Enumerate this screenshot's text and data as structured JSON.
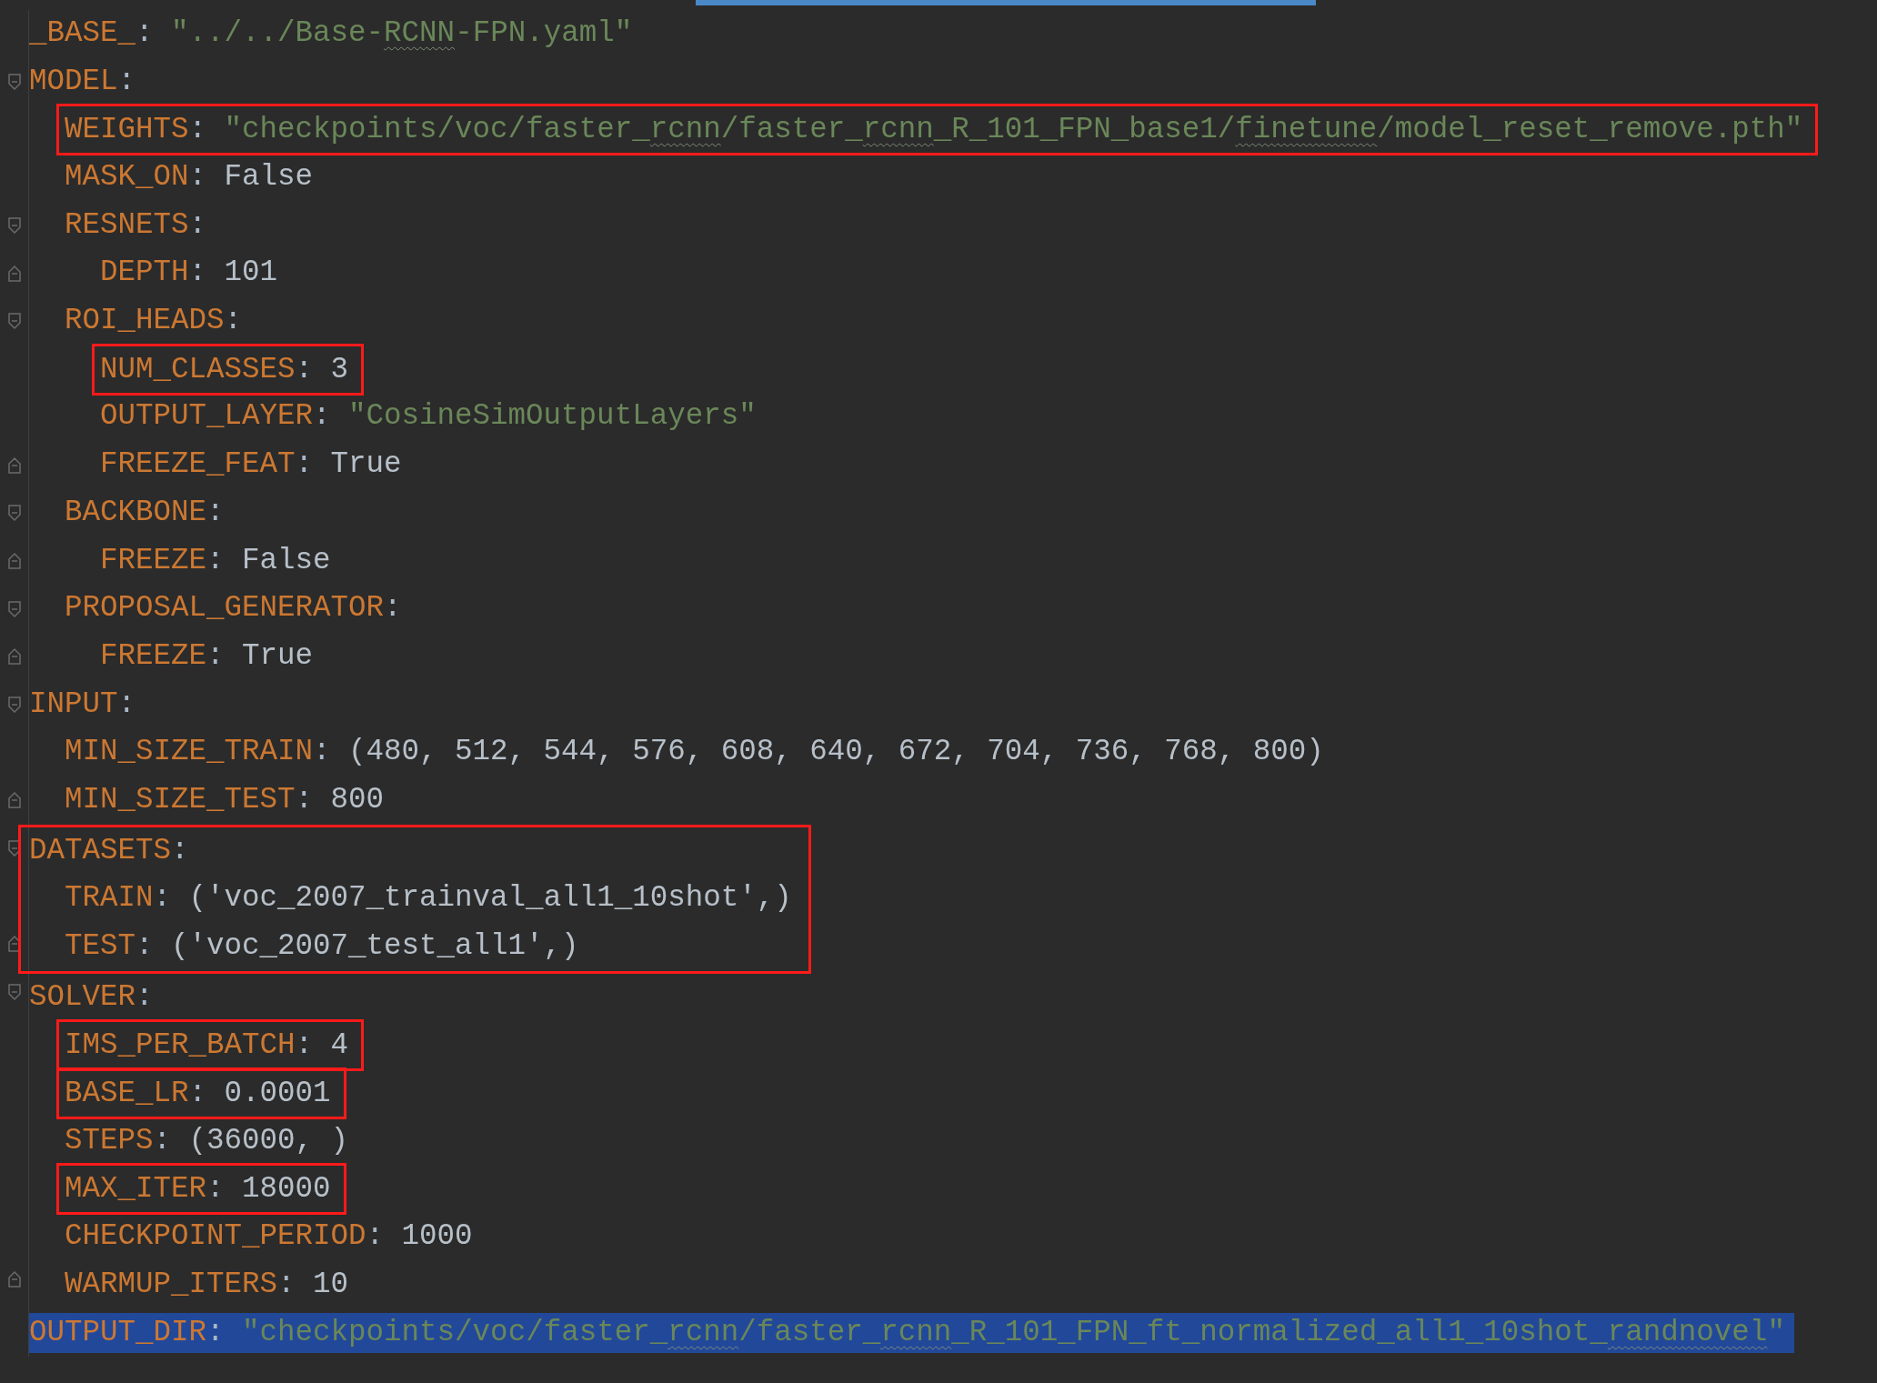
{
  "editor": {
    "lines": [
      {
        "key": "_BASE_",
        "sep": ":",
        "kind": "string",
        "value_parts": [
          {
            "text": "\"../../Base-",
            "typo": false
          },
          {
            "text": "RCNN",
            "typo": true
          },
          {
            "text": "-FPN.yaml\"",
            "typo": false
          }
        ],
        "highlighted": false,
        "selected": false
      },
      {
        "key": "MODEL",
        "sep": ":",
        "highlighted": false,
        "selected": false,
        "children": [
          {
            "key": "WEIGHTS",
            "sep": ":",
            "kind": "string",
            "value_parts": [
              {
                "text": "\"checkpoints/voc/faster_",
                "typo": false
              },
              {
                "text": "rcnn",
                "typo": true
              },
              {
                "text": "/faster_",
                "typo": false
              },
              {
                "text": "rcnn",
                "typo": true
              },
              {
                "text": "_R_101_FPN_base1/",
                "typo": false
              },
              {
                "text": "finetune",
                "typo": true
              },
              {
                "text": "/model_reset_remove.pth\"",
                "typo": false
              }
            ],
            "highlighted": true,
            "selected": false
          },
          {
            "key": "MASK_ON",
            "sep": ":",
            "kind": "plain",
            "value": "False",
            "highlighted": false,
            "selected": false
          },
          {
            "key": "RESNETS",
            "sep": ":",
            "highlighted": false,
            "selected": false,
            "children": [
              {
                "key": "DEPTH",
                "sep": ":",
                "kind": "plain",
                "value": "101",
                "highlighted": false,
                "selected": false
              }
            ]
          },
          {
            "key": "ROI_HEADS",
            "sep": ":",
            "highlighted": false,
            "selected": false,
            "children": [
              {
                "key": "NUM_CLASSES",
                "sep": ":",
                "kind": "plain",
                "value": "3",
                "highlighted": true,
                "selected": false
              },
              {
                "key": "OUTPUT_LAYER",
                "sep": ":",
                "kind": "string",
                "value": "\"CosineSimOutputLayers\"",
                "highlighted": false,
                "selected": false
              },
              {
                "key": "FREEZE_FEAT",
                "sep": ":",
                "kind": "plain",
                "value": "True",
                "highlighted": false,
                "selected": false
              }
            ]
          },
          {
            "key": "BACKBONE",
            "sep": ":",
            "highlighted": false,
            "selected": false,
            "children": [
              {
                "key": "FREEZE",
                "sep": ":",
                "kind": "plain",
                "value": "False",
                "highlighted": false,
                "selected": false
              }
            ]
          },
          {
            "key": "PROPOSAL_GENERATOR",
            "sep": ":",
            "highlighted": false,
            "selected": false,
            "children": [
              {
                "key": "FREEZE",
                "sep": ":",
                "kind": "plain",
                "value": "True",
                "highlighted": false,
                "selected": false
              }
            ]
          }
        ]
      },
      {
        "key": "INPUT",
        "sep": ":",
        "highlighted": false,
        "selected": false,
        "children": [
          {
            "key": "MIN_SIZE_TRAIN",
            "sep": ":",
            "kind": "plain",
            "value": "(480, 512, 544, 576, 608, 640, 672, 704, 736, 768, 800)",
            "highlighted": false,
            "selected": false
          },
          {
            "key": "MIN_SIZE_TEST",
            "sep": ":",
            "kind": "plain",
            "value": "800",
            "highlighted": false,
            "selected": false
          }
        ]
      },
      {
        "key": "DATASETS",
        "sep": ":",
        "highlighted": true,
        "selected": false,
        "children": [
          {
            "key": "TRAIN",
            "sep": ":",
            "kind": "plain",
            "value": "('voc_2007_trainval_all1_10shot',)",
            "highlighted": false,
            "selected": false
          },
          {
            "key": "TEST",
            "sep": ":",
            "kind": "plain",
            "value": "('voc_2007_test_all1',)",
            "highlighted": false,
            "selected": false
          }
        ]
      },
      {
        "key": "SOLVER",
        "sep": ":",
        "highlighted": false,
        "selected": false,
        "children": [
          {
            "key": "IMS_PER_BATCH",
            "sep": ":",
            "kind": "plain",
            "value": "4",
            "highlighted": true,
            "selected": false
          },
          {
            "key": "BASE_LR",
            "sep": ":",
            "kind": "plain",
            "value": "0.0001",
            "highlighted": true,
            "selected": false
          },
          {
            "key": "STEPS",
            "sep": ":",
            "kind": "plain",
            "value": "(36000, )",
            "highlighted": false,
            "selected": false
          },
          {
            "key": "MAX_ITER",
            "sep": ":",
            "kind": "plain",
            "value": "18000",
            "highlighted": true,
            "selected": false
          },
          {
            "key": "CHECKPOINT_PERIOD",
            "sep": ":",
            "kind": "plain",
            "value": "1000",
            "highlighted": false,
            "selected": false
          },
          {
            "key": "WARMUP_ITERS",
            "sep": ":",
            "kind": "plain",
            "value": "10",
            "highlighted": false,
            "selected": false
          }
        ]
      },
      {
        "key": "OUTPUT_DIR",
        "sep": ":",
        "kind": "string",
        "value_parts": [
          {
            "text": "\"checkpoints/voc/faster_",
            "typo": false
          },
          {
            "text": "rcnn",
            "typo": true
          },
          {
            "text": "/faster_",
            "typo": false
          },
          {
            "text": "rcnn",
            "typo": true
          },
          {
            "text": "_R_101_FPN_ft_normalized_all1_10shot_",
            "typo": false
          },
          {
            "text": "randnovel",
            "typo": true
          },
          {
            "text": "\"",
            "typo": false
          }
        ],
        "highlighted": false,
        "selected": true
      }
    ]
  }
}
